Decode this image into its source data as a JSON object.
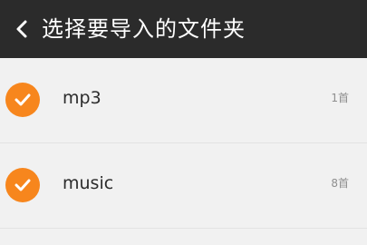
{
  "header": {
    "title": "选择要导入的文件夹",
    "back_icon": "chevron-left-icon"
  },
  "folders": [
    {
      "name": "mp3",
      "count": "1首",
      "checked": true
    },
    {
      "name": "music",
      "count": "8首",
      "checked": true
    }
  ],
  "colors": {
    "header_bg": "#2b2b2b",
    "accent": "#f7861d",
    "list_bg": "#f1f1f1"
  }
}
